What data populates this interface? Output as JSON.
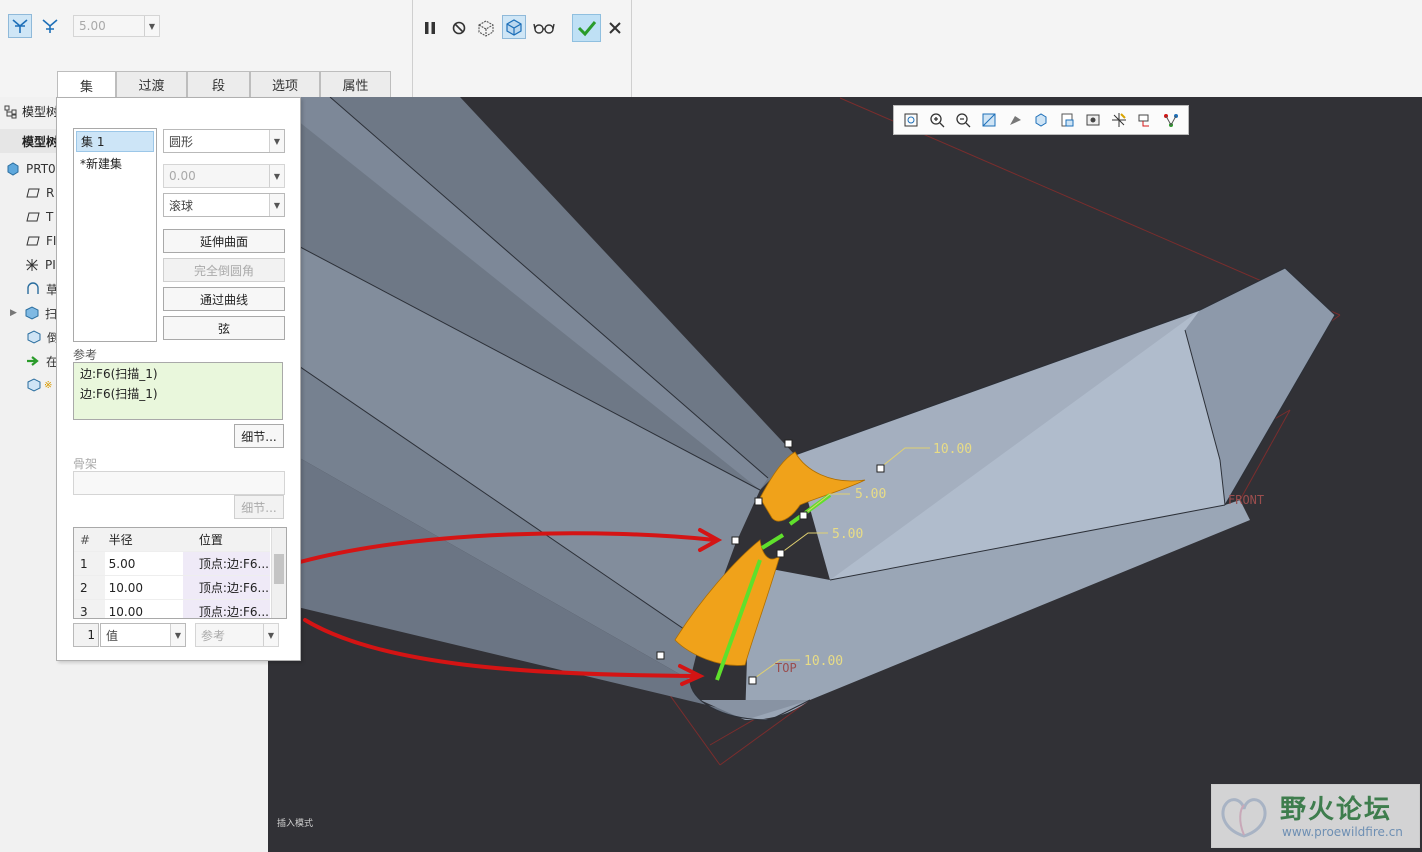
{
  "ribbon": {
    "radius_value": "5.00",
    "tabs": [
      "集",
      "过渡",
      "段",
      "选项",
      "属性"
    ]
  },
  "tree": {
    "header": "模型树",
    "sub_header": "模型树",
    "items": [
      "PRT0",
      "R",
      "T",
      "FI",
      "PI",
      "草",
      "扫",
      "倒",
      "在",
      "※"
    ]
  },
  "panel": {
    "sets": [
      "集 1",
      "*新建集"
    ],
    "shape_select": "圆形",
    "value_select": "0.00",
    "method_select": "滚球",
    "buttons": [
      "延伸曲面",
      "完全倒圆角",
      "通过曲线",
      "弦"
    ],
    "references_label": "参考",
    "references": [
      "边:F6(扫描_1)",
      "边:F6(扫描_1)"
    ],
    "details_button": "细节...",
    "skeleton_label": "骨架",
    "skeleton_details_button": "细节...",
    "radius_table": {
      "headers": [
        "#",
        "半径",
        "位置"
      ],
      "rows": [
        {
          "index": "1",
          "radius": "5.00",
          "location": "顶点:边:F6..."
        },
        {
          "index": "2",
          "radius": "10.00",
          "location": "顶点:边:F6..."
        },
        {
          "index": "3",
          "radius": "10.00",
          "location": "顶点:边:F6..."
        }
      ]
    },
    "bottom": {
      "index": "1",
      "mode_select": "值",
      "ref_select": "参考"
    }
  },
  "viewport": {
    "dimension_labels": [
      "10.00",
      "5.00",
      "5.00",
      "10.00"
    ],
    "datum_labels": [
      "FRONT",
      "TOP"
    ],
    "mode_text": "插入模式"
  },
  "watermark": {
    "name": "野火论坛",
    "url": "www.proewildfire.cn"
  },
  "colors": {
    "viewport_bg": "#313136",
    "model_face": "#8a96a6",
    "round_surface": "#f0a21a",
    "green_curve": "#5fe02c",
    "annotation_red": "#d41414",
    "ok_green": "#2a9b2a"
  }
}
